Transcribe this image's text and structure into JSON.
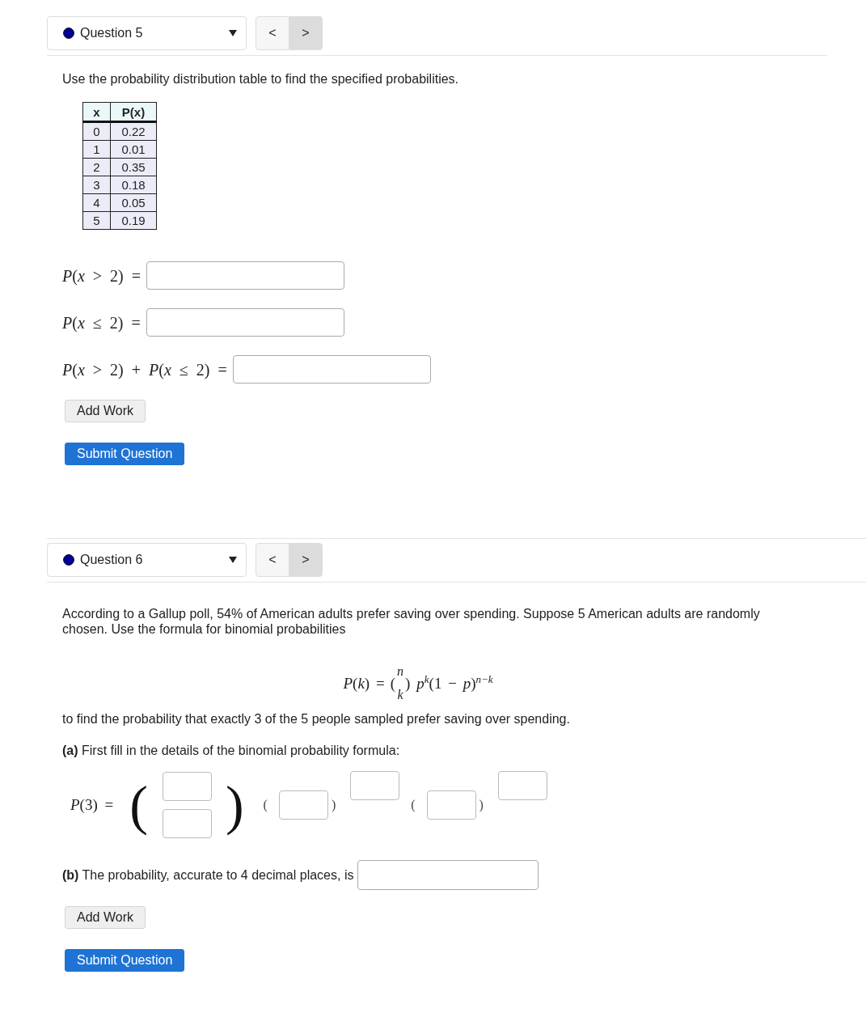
{
  "questions": [
    {
      "selector": {
        "label": "Question 5",
        "color": "#000099"
      },
      "nav": [
        {
          "label": "<",
          "active": false
        },
        {
          "label": ">",
          "active": true
        }
      ],
      "content": [
        {
          "kind": "paragraph",
          "text": "Use the probability distribution table to find the specified probabilities."
        },
        {
          "kind": "table",
          "columns": [
            "x",
            "P(x)"
          ],
          "rows": [
            [
              "0",
              "0.22"
            ],
            [
              "1",
              "0.01"
            ],
            [
              "2",
              "0.35"
            ],
            [
              "3",
              "0.18"
            ],
            [
              "4",
              "0.05"
            ],
            [
              "5",
              "0.19"
            ]
          ]
        },
        {
          "kind": "math-answer",
          "expression": "*P*(*x* > 2) ="
        },
        {
          "kind": "math-answer",
          "expression": "*P*(*x* ≤ 2) ="
        },
        {
          "kind": "math-answer",
          "expression": "*P*(*x* > 2) + *P*(*x* ≤ 2) ="
        }
      ],
      "buttons": [
        {
          "kind": "add-work",
          "label": "Add Work"
        },
        {
          "kind": "submit",
          "label": "Submit Question"
        }
      ]
    },
    {
      "selector": {
        "label": "Question 6",
        "color": "#000099"
      },
      "nav": [
        {
          "label": "<",
          "active": false
        },
        {
          "label": ">",
          "active": true
        }
      ],
      "content": [
        {
          "kind": "paragraph",
          "text": "According to a Gallup poll, 54% of American adults prefer saving over spending. Suppose 5 American adults are randomly chosen. Use the formula for binomial probabilities"
        },
        {
          "kind": "formula",
          "lhs": "*P*(*k*) =",
          "open": "(",
          "top": "n",
          "bottom": "k",
          "close": ")",
          "rhs": "*p*$^{k}$(1 − *p*)$^{n−k}$"
        },
        {
          "kind": "paragraph",
          "text": "to find the probability that exactly 3 of the 5 people sampled prefer saving over spending."
        },
        {
          "kind": "paragraph",
          "text": "**(a)** First fill in the details of the binomial probability formula:"
        },
        {
          "kind": "binomial-entry",
          "terms": [
            {
              "kind": "expression",
              "text": "*P*(3) ="
            },
            {
              "kind": "big-paren",
              "text": "("
            },
            {
              "kind": "field-stack"
            },
            {
              "kind": "big-paren",
              "text": ")"
            },
            {
              "kind": "paren",
              "text": "("
            },
            {
              "kind": "field"
            },
            {
              "kind": "paren",
              "text": ")"
            },
            {
              "kind": "exponent-field"
            },
            {
              "kind": "paren",
              "text": "("
            },
            {
              "kind": "field"
            },
            {
              "kind": "paren",
              "text": ")"
            },
            {
              "kind": "exponent-field"
            }
          ]
        },
        {
          "kind": "text-answer",
          "text": "**(b)** The probability, accurate to 4 decimal places, is"
        }
      ],
      "buttons": [
        {
          "kind": "add-work",
          "label": "Add Work"
        },
        {
          "kind": "submit",
          "label": "Submit Question"
        }
      ]
    }
  ]
}
